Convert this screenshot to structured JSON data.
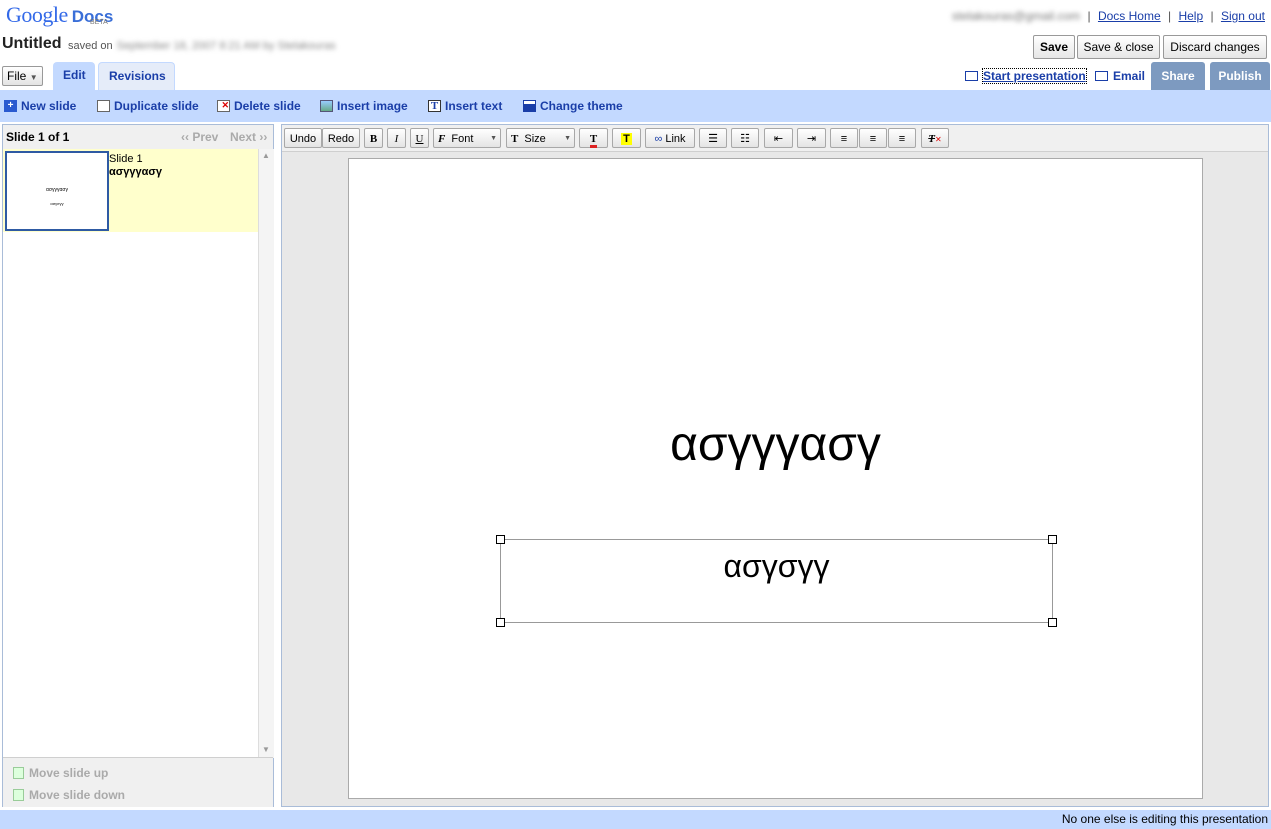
{
  "header": {
    "logo": "Google",
    "logo_product": "Docs",
    "logo_badge": "BETA",
    "account_email": "stelakouras@gmail.com",
    "links": [
      "Docs Home",
      "Help",
      "Sign out"
    ],
    "doc_title": "Untitled",
    "saved_prefix": "saved on",
    "saved_detail": "September 18, 2007 8:21 AM by Stelakouras",
    "buttons": {
      "save": "Save",
      "save_close": "Save & close",
      "discard": "Discard changes"
    }
  },
  "tabs": {
    "file": "File",
    "edit": "Edit",
    "revisions": "Revisions"
  },
  "right_actions": {
    "start_presentation": "Start presentation",
    "email": "Email",
    "share": "Share",
    "publish": "Publish"
  },
  "actions": {
    "new_slide": "New slide",
    "duplicate_slide": "Duplicate slide",
    "delete_slide": "Delete slide",
    "insert_image": "Insert image",
    "insert_text": "Insert text",
    "change_theme": "Change theme"
  },
  "slide_panel": {
    "count": "Slide 1 of 1",
    "prev": "‹‹ Prev",
    "next": "Next ››",
    "slides": [
      {
        "label": "Slide 1",
        "title": "ασγγγασγ",
        "subtitle": "ασγσγγ"
      }
    ],
    "move_up": "Move slide up",
    "move_down": "Move slide down"
  },
  "toolbar": {
    "undo": "Undo",
    "redo": "Redo",
    "bold": "B",
    "italic": "I",
    "underline": "U",
    "font": "Font",
    "size": "Size",
    "link": "Link"
  },
  "slide": {
    "title": "ασγγγασγ",
    "body": "ασγσγγ"
  },
  "status": "No one else is editing this presentation",
  "colors": {
    "accent_bar": "#c3d9ff",
    "link": "#1a3ea8",
    "thumb_highlight": "#ffffcc",
    "share_tab": "#7d9ac0"
  }
}
